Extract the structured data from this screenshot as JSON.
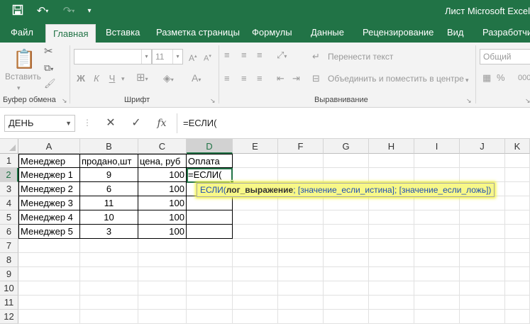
{
  "window": {
    "title": "Лист Microsoft Excel"
  },
  "qat": {
    "icons": [
      "save-icon",
      "undo-icon",
      "redo-icon",
      "customize-qat-icon"
    ]
  },
  "tabs": [
    "Файл",
    "Главная",
    "Вставка",
    "Разметка страницы",
    "Формулы",
    "Данные",
    "Рецензирование",
    "Вид",
    "Разработчик"
  ],
  "active_tab": "Главная",
  "ribbon": {
    "clipboard": {
      "paste_label": "Вставить",
      "group_label": "Буфер обмена"
    },
    "font": {
      "font_name": "",
      "font_size": "11",
      "bold": "Ж",
      "italic": "К",
      "underline": "Ч",
      "group_label": "Шрифт"
    },
    "alignment": {
      "wrap_text": "Перенести текст",
      "merge_center": "Объединить и поместить в центре",
      "group_label": "Выравнивание"
    },
    "number": {
      "format": "Общий"
    }
  },
  "formula_bar": {
    "name_box": "ДЕНЬ",
    "cancel": "✕",
    "enter": "✓",
    "fx": "fx",
    "content": "=ЕСЛИ("
  },
  "columns": [
    "A",
    "B",
    "C",
    "D",
    "E",
    "F",
    "G",
    "H",
    "I",
    "J",
    "K"
  ],
  "rows": [
    "1",
    "2",
    "3",
    "4",
    "5",
    "6",
    "7",
    "8",
    "9",
    "10",
    "11",
    "12"
  ],
  "selected": {
    "column": "D",
    "row": "2"
  },
  "table": {
    "headers": [
      "Менеджер",
      "продано,шт",
      "цена, руб",
      "Оплата"
    ],
    "rows": [
      [
        "Менеджер 1",
        "9",
        "100",
        "=ЕСЛИ("
      ],
      [
        "Менеджер 2",
        "6",
        "100",
        ""
      ],
      [
        "Менеджер 3",
        "11",
        "100",
        ""
      ],
      [
        "Менеджер 4",
        "10",
        "100",
        ""
      ],
      [
        "Менеджер 5",
        "3",
        "100",
        ""
      ]
    ]
  },
  "tooltip": {
    "fn": "ЕСЛИ(",
    "arg1": "лог_выражение",
    "rest": "; [значение_если_истина]; [значение_если_ложь])"
  }
}
